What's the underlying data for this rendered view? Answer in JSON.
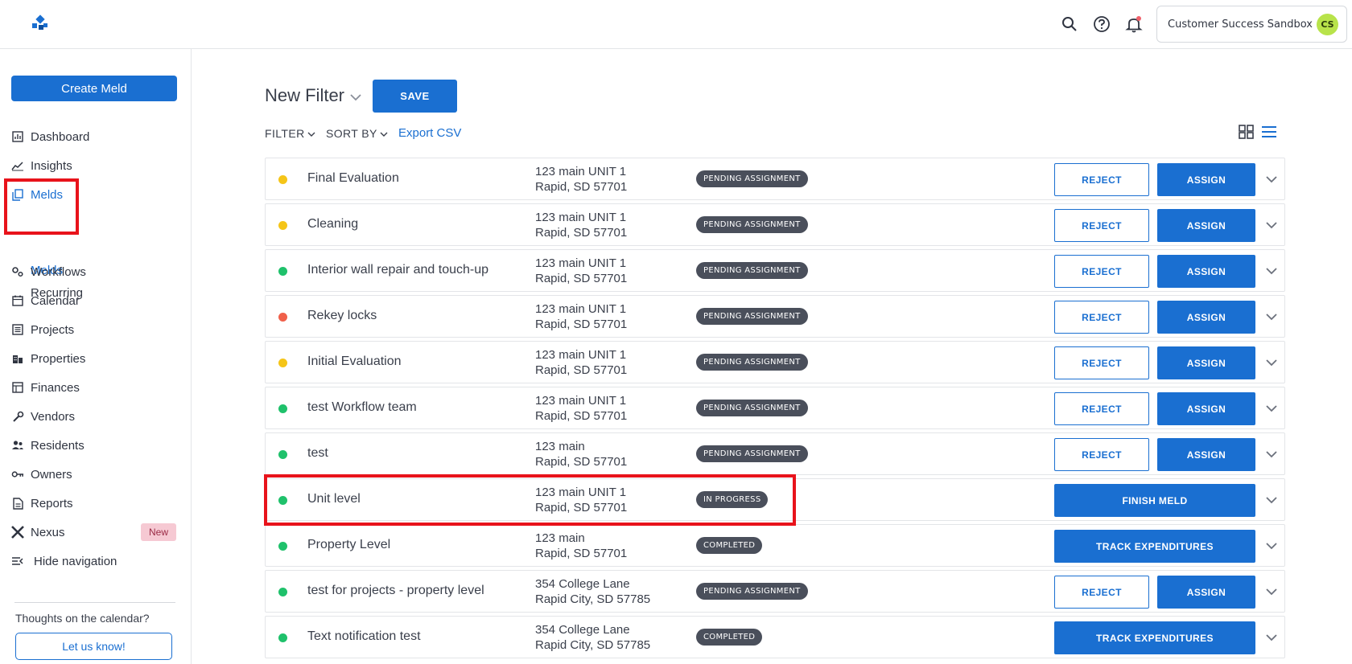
{
  "header": {
    "org_name": "Customer Success Sandbox",
    "avatar_initials": "CS",
    "accent": "#1a6fd1",
    "notification_dot_color": "#f0606a"
  },
  "sidebar": {
    "create_label": "Create Meld",
    "items": [
      {
        "label": "Dashboard",
        "icon": "dashboard-icon"
      },
      {
        "label": "Insights",
        "icon": "insights-icon"
      },
      {
        "label": "Melds",
        "icon": "melds-icon"
      },
      {
        "label": "Workflows",
        "icon": "workflows-icon"
      },
      {
        "label": "Calendar",
        "icon": "calendar-icon"
      },
      {
        "label": "Projects",
        "icon": "projects-icon"
      },
      {
        "label": "Properties",
        "icon": "properties-icon"
      },
      {
        "label": "Finances",
        "icon": "finances-icon"
      },
      {
        "label": "Vendors",
        "icon": "vendors-icon"
      },
      {
        "label": "Residents",
        "icon": "residents-icon"
      },
      {
        "label": "Owners",
        "icon": "owners-icon"
      },
      {
        "label": "Reports",
        "icon": "reports-icon"
      },
      {
        "label": "Nexus",
        "icon": "nexus-icon",
        "badge": "New"
      },
      {
        "label": "Hide navigation",
        "icon": "hide-navigation-icon"
      }
    ],
    "sub_items": [
      {
        "label": "Melds"
      },
      {
        "label": "Recurring"
      }
    ],
    "feedback_prompt": "Thoughts on the calendar?",
    "feedback_button": "Let us know!"
  },
  "filter_bar": {
    "title": "New Filter",
    "save_label": "SAVE",
    "filter_label": "FILTER",
    "sort_label": "SORT BY",
    "export_label": "Export CSV"
  },
  "rows": [
    {
      "title": "Final Evaluation",
      "addr1": "123 main UNIT 1",
      "addr2": "Rapid, SD 57701",
      "status": "PENDING ASSIGNMENT",
      "priority_color": "#f5c518",
      "actions": {
        "reject": "REJECT",
        "assign": "ASSIGN"
      }
    },
    {
      "title": "Cleaning",
      "addr1": "123 main UNIT 1",
      "addr2": "Rapid, SD 57701",
      "status": "PENDING ASSIGNMENT",
      "priority_color": "#f5c518",
      "actions": {
        "reject": "REJECT",
        "assign": "ASSIGN"
      }
    },
    {
      "title": "Interior wall repair and touch-up",
      "addr1": "123 main UNIT 1",
      "addr2": "Rapid, SD 57701",
      "status": "PENDING ASSIGNMENT",
      "priority_color": "#1fc16b",
      "actions": {
        "reject": "REJECT",
        "assign": "ASSIGN"
      }
    },
    {
      "title": "Rekey locks",
      "addr1": "123 main UNIT 1",
      "addr2": "Rapid, SD 57701",
      "status": "PENDING ASSIGNMENT",
      "priority_color": "#f0604a",
      "actions": {
        "reject": "REJECT",
        "assign": "ASSIGN"
      }
    },
    {
      "title": "Initial Evaluation",
      "addr1": "123 main UNIT 1",
      "addr2": "Rapid, SD 57701",
      "status": "PENDING ASSIGNMENT",
      "priority_color": "#f5c518",
      "actions": {
        "reject": "REJECT",
        "assign": "ASSIGN"
      }
    },
    {
      "title": "test Workflow team",
      "addr1": "123 main UNIT 1",
      "addr2": "Rapid, SD 57701",
      "status": "PENDING ASSIGNMENT",
      "priority_color": "#1fc16b",
      "actions": {
        "reject": "REJECT",
        "assign": "ASSIGN"
      }
    },
    {
      "title": "test",
      "addr1": "123 main",
      "addr2": "Rapid, SD 57701",
      "status": "PENDING ASSIGNMENT",
      "priority_color": "#1fc16b",
      "actions": {
        "reject": "REJECT",
        "assign": "ASSIGN"
      }
    },
    {
      "title": "Unit level",
      "addr1": "123 main UNIT 1",
      "addr2": "Rapid, SD 57701",
      "status": "IN PROGRESS",
      "priority_color": "#1fc16b",
      "actions": {
        "primary": "FINISH MELD"
      }
    },
    {
      "title": "Property Level",
      "addr1": "123 main",
      "addr2": "Rapid, SD 57701",
      "status": "COMPLETED",
      "priority_color": "#1fc16b",
      "actions": {
        "primary": "TRACK EXPENDITURES"
      }
    },
    {
      "title": "test for projects - property level",
      "addr1": "354 College Lane",
      "addr2": "Rapid City, SD 57785",
      "status": "PENDING ASSIGNMENT",
      "priority_color": "#1fc16b",
      "actions": {
        "reject": "REJECT",
        "assign": "ASSIGN"
      }
    },
    {
      "title": "Text notification test",
      "addr1": "354 College Lane",
      "addr2": "Rapid City, SD 57785",
      "status": "COMPLETED",
      "priority_color": "#1fc16b",
      "actions": {
        "primary": "TRACK EXPENDITURES"
      }
    }
  ]
}
